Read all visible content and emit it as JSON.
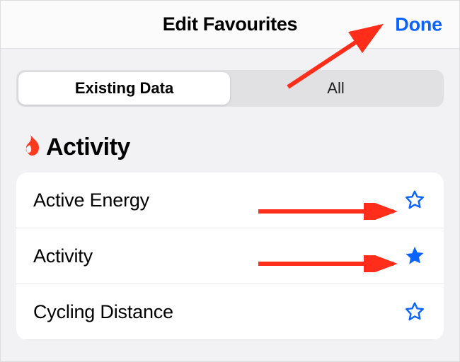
{
  "header": {
    "title": "Edit Favourites",
    "done_label": "Done"
  },
  "segmented": {
    "existing_label": "Existing Data",
    "all_label": "All"
  },
  "section": {
    "icon": "flame",
    "title": "Activity"
  },
  "rows": [
    {
      "label": "Active Energy",
      "favourite": false
    },
    {
      "label": "Activity",
      "favourite": true
    },
    {
      "label": "Cycling Distance",
      "favourite": false
    }
  ],
  "colors": {
    "accent": "#0a63ff",
    "flame": "#ff3a1f",
    "annotate": "#ff2d1a"
  }
}
